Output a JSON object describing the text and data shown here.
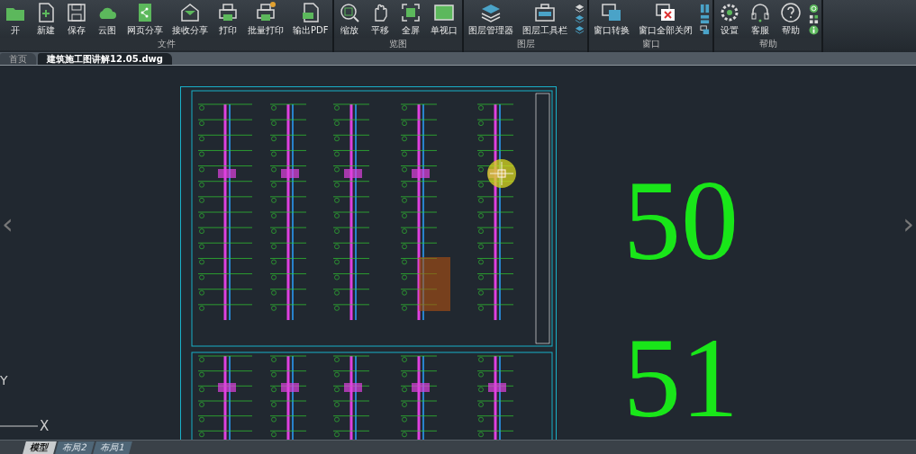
{
  "ribbon": {
    "groups": [
      {
        "label": "文件",
        "buttons": [
          "开",
          "新建",
          "保存",
          "云图",
          "网页分享",
          "接收分享",
          "打印",
          "批量打印",
          "输出PDF"
        ]
      },
      {
        "label": "览图",
        "buttons": [
          "缩放",
          "平移",
          "全屏",
          "单视口"
        ]
      },
      {
        "label": "图层",
        "buttons": [
          "图层管理器",
          "图层工具栏"
        ]
      },
      {
        "label": "窗口",
        "buttons": [
          "窗口转换",
          "窗口全部关闭"
        ]
      },
      {
        "label": "帮助",
        "buttons": [
          "设置",
          "客服",
          "帮助"
        ]
      }
    ]
  },
  "doc_tabs": [
    {
      "label": "首页",
      "selected": false
    },
    {
      "label": "建筑施工图讲解12.05.dwg",
      "selected": true
    }
  ],
  "canvas": {
    "prev": "‹",
    "next": "›",
    "axis_y": "Y",
    "axis_x": "X",
    "sheet_numbers": [
      "50",
      "51"
    ]
  },
  "layout_tabs": [
    {
      "label": "模型",
      "selected": true
    },
    {
      "label": "布局2",
      "selected": false
    },
    {
      "label": "布局1",
      "selected": false
    }
  ]
}
